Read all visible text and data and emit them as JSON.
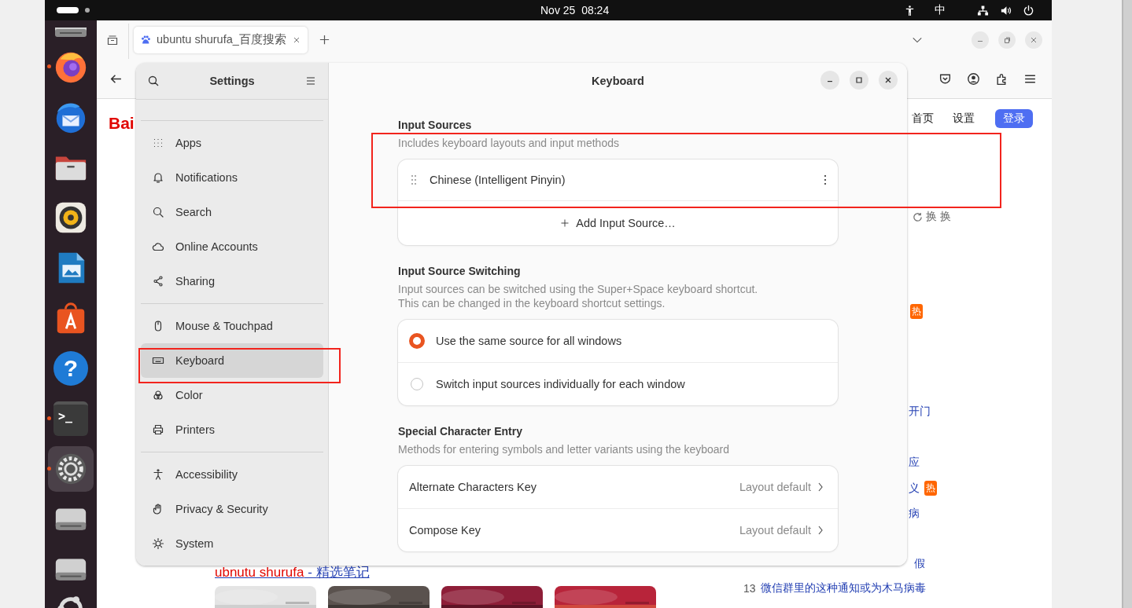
{
  "top_bar": {
    "date_time": "Nov 25  08:24",
    "input_method": "中"
  },
  "dock": [
    {
      "kind": "drive",
      "running": false,
      "focused": false
    },
    {
      "kind": "browser",
      "running": true,
      "focused": false
    },
    {
      "kind": "mail",
      "running": false,
      "focused": false
    },
    {
      "kind": "files",
      "running": false,
      "focused": false
    },
    {
      "kind": "music",
      "running": false,
      "focused": false
    },
    {
      "kind": "writer",
      "running": false,
      "focused": false
    },
    {
      "kind": "store",
      "running": false,
      "focused": false
    },
    {
      "kind": "help",
      "glyph": "?",
      "running": false,
      "focused": false
    },
    {
      "kind": "terminal",
      "glyph": ">_",
      "running": true,
      "focused": false
    },
    {
      "kind": "settings",
      "running": true,
      "focused": true
    },
    {
      "kind": "drive",
      "running": false,
      "focused": false
    },
    {
      "kind": "drive",
      "running": false,
      "focused": false
    },
    {
      "kind": "ubuntu",
      "running": false,
      "focused": false
    }
  ],
  "browser": {
    "tab": {
      "title": "ubuntu shurufa_百度搜索",
      "selected": true
    },
    "page": {
      "logo": "Bai",
      "nav": [
        "首页",
        "设置"
      ],
      "login": "登录",
      "refresh": "换 换",
      "hot_list": [
        {
          "badge": "热"
        },
        {
          "text": "开门"
        },
        {
          "text": "应"
        },
        {
          "text": "义",
          "badge": "热"
        },
        {
          "text": "病"
        },
        {
          "text": "假"
        },
        {
          "rank": "13",
          "text": "微信群里的这种通知或为木马病毒"
        }
      ],
      "result_link": {
        "title": "ubnutu shurufa",
        "suffix": " - 精选笔记"
      },
      "thumbnails": [
        {
          "kind": "picture"
        },
        {
          "kind": "picture"
        },
        {
          "kind": "picture"
        },
        {
          "kind": "picture"
        }
      ]
    }
  },
  "settings": {
    "sidebar": {
      "title": "Settings",
      "groups": [
        [
          {
            "label": "Apps",
            "kind": "apps",
            "selected": false,
            "outlined": false
          },
          {
            "label": "Notifications",
            "kind": "bell",
            "selected": false,
            "outlined": false
          },
          {
            "label": "Search",
            "kind": "search",
            "selected": false,
            "outlined": false
          },
          {
            "label": "Online Accounts",
            "kind": "cloud",
            "selected": false,
            "outlined": false
          },
          {
            "label": "Sharing",
            "kind": "share",
            "selected": false,
            "outlined": false
          }
        ],
        [
          {
            "label": "Mouse & Touchpad",
            "kind": "mouse",
            "selected": false,
            "outlined": false
          },
          {
            "label": "Keyboard",
            "kind": "keyboard",
            "selected": true,
            "outlined": true
          },
          {
            "label": "Color",
            "kind": "color",
            "selected": false,
            "outlined": false
          },
          {
            "label": "Printers",
            "kind": "printer",
            "selected": false,
            "outlined": false
          }
        ],
        [
          {
            "label": "Accessibility",
            "kind": "accessibility",
            "selected": false,
            "outlined": false
          },
          {
            "label": "Privacy & Security",
            "kind": "hand",
            "selected": false,
            "outlined": false
          },
          {
            "label": "System",
            "kind": "gear",
            "selected": false,
            "outlined": false
          }
        ]
      ]
    },
    "page": {
      "title": "Keyboard",
      "sections": [
        {
          "kind": "sources",
          "title": "Input Sources",
          "description": "Includes keyboard layouts and input methods",
          "outlined": true,
          "sources": [
            "Chinese (Intelligent Pinyin)"
          ],
          "add_label": "Add Input Source…"
        },
        {
          "kind": "radio",
          "title": "Input Source Switching",
          "description": "Input sources can be switched using the Super+Space keyboard shortcut.\nThis can be changed in the keyboard shortcut settings.",
          "outlined": false,
          "options": [
            {
              "label": "Use the same source for all windows",
              "selected": true
            },
            {
              "label": "Switch input sources individually for each window",
              "selected": false
            }
          ]
        },
        {
          "kind": "links",
          "title": "Special Character Entry",
          "description": "Methods for entering symbols and letter variants using the keyboard",
          "outlined": false,
          "rows": [
            {
              "label": "Alternate Characters Key",
              "value": "Layout default"
            },
            {
              "label": "Compose Key",
              "value": "Layout default"
            }
          ]
        }
      ]
    }
  }
}
